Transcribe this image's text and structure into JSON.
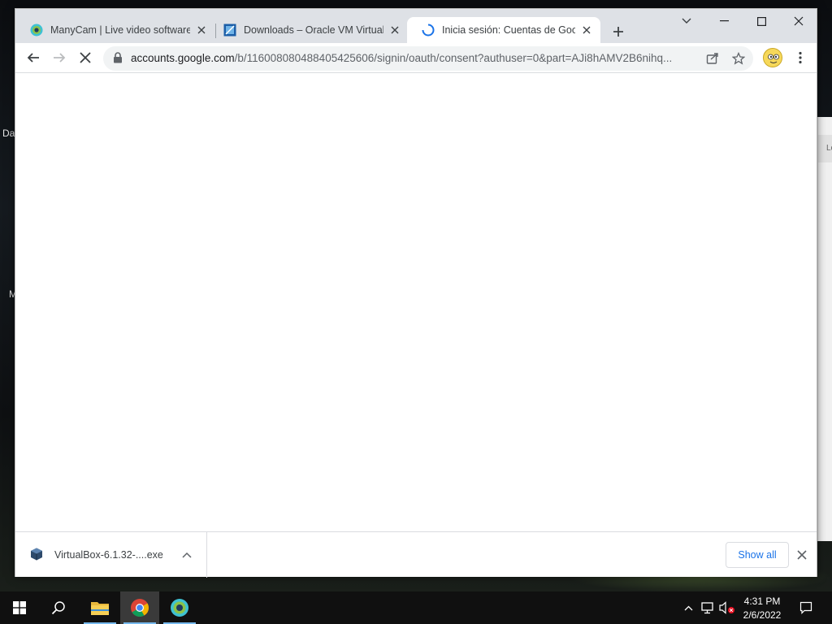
{
  "desktop": {
    "labels": [
      "Da",
      "M"
    ],
    "background_window_text": "Lo"
  },
  "browser": {
    "tabs": [
      {
        "title": "ManyCam | Live video software &",
        "icon": "manycam-icon",
        "active": false
      },
      {
        "title": "Downloads – Oracle VM VirtualBox",
        "icon": "virtualbox-icon",
        "active": false
      },
      {
        "title": "Inicia sesión: Cuentas de Google",
        "icon": "loading-spinner-icon",
        "active": true
      }
    ],
    "toolbar": {
      "url_host": "accounts.google.com",
      "url_path": "/b/116008080488405425606/signin/oauth/consent?authuser=0&part=AJi8hAMV2B6nihq..."
    },
    "downloads": {
      "items": [
        {
          "name": "VirtualBox-6.1.32-....exe",
          "icon": "virtualbox-icon"
        }
      ],
      "show_all_label": "Show all"
    }
  },
  "taskbar": {
    "apps": [
      "file-explorer-icon",
      "chrome-icon",
      "manycam-icon"
    ],
    "time": "4:31 PM",
    "date": "2/6/2022"
  },
  "colors": {
    "titlebar": "#dee1e6",
    "accent_blue": "#1a73e8",
    "taskbar": "#101010"
  }
}
